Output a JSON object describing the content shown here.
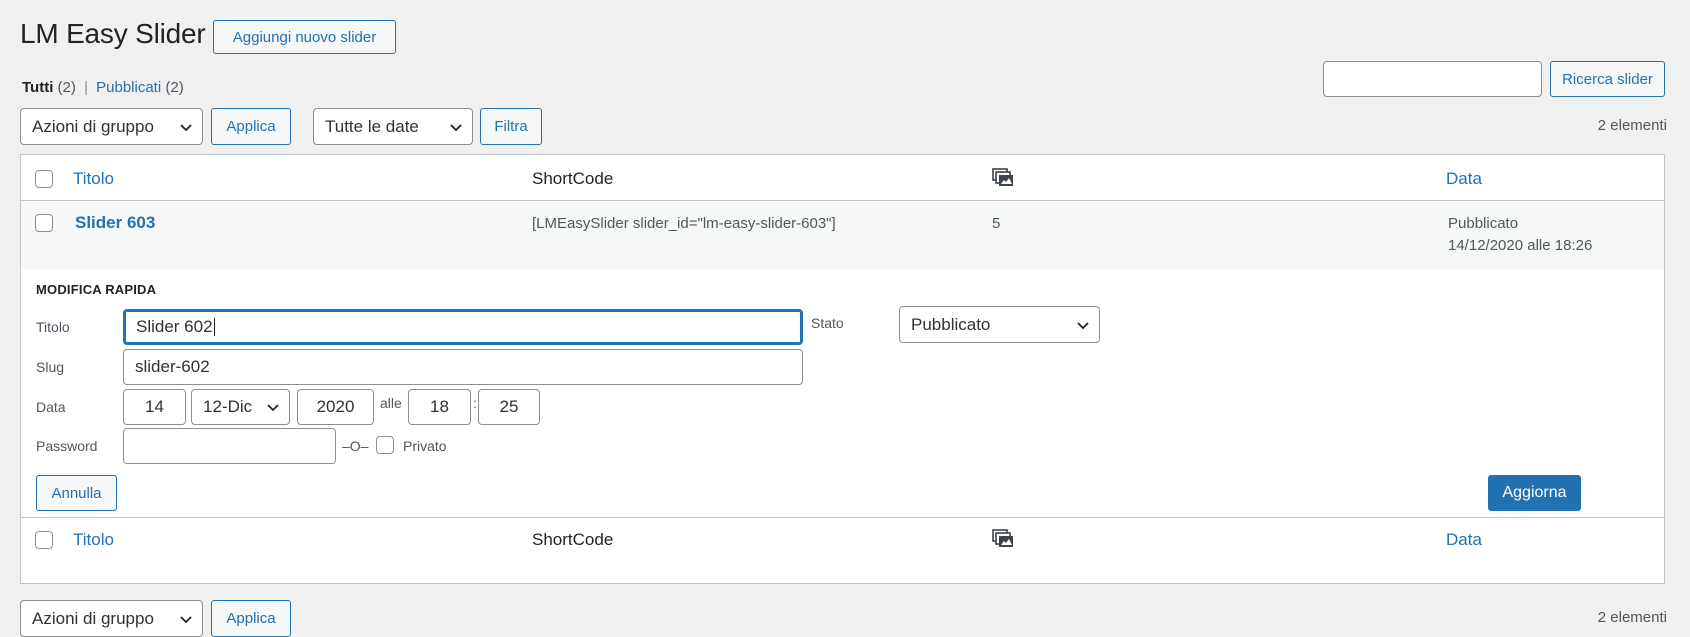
{
  "page": {
    "title": "LM Easy Slider",
    "add_new_label": "Aggiungi nuovo slider"
  },
  "views": {
    "all_label": "Tutti",
    "all_count": "(2)",
    "separator": "|",
    "published_label": "Pubblicati",
    "published_count": "(2)"
  },
  "search": {
    "value": "",
    "button_label": "Ricerca slider"
  },
  "tablenav_top": {
    "bulk_actions": "Azioni di gruppo",
    "apply_label": "Applica",
    "date_filter": "Tutte le date",
    "filter_label": "Filtra",
    "items_count": "2 elementi"
  },
  "table": {
    "columns": {
      "title": "Titolo",
      "shortcode": "ShortCode",
      "slides_icon": "images-icon",
      "date": "Data"
    },
    "rows": [
      {
        "title": "Slider 603",
        "shortcode": "[LMEasySlider slider_id=\"lm-easy-slider-603\"]",
        "slides": "5",
        "status": "Pubblicato",
        "date": "14/12/2020 alle 18:26"
      }
    ]
  },
  "quick_edit": {
    "heading": "MODIFICA RAPIDA",
    "title_label": "Titolo",
    "title_value": "Slider 602",
    "slug_label": "Slug",
    "slug_value": "slider-602",
    "date_label": "Data",
    "day": "14",
    "month": "12-Dic",
    "year": "2020",
    "at_label": "alle",
    "hour": "18",
    "time_sep": ":",
    "minute": "25",
    "password_label": "Password",
    "password_value": "",
    "or_label": "–O–",
    "private_label": "Privato",
    "status_label": "Stato",
    "status_value": "Pubblicato",
    "cancel_label": "Annulla",
    "update_label": "Aggiorna"
  },
  "tablenav_bottom": {
    "bulk_actions": "Azioni di gruppo",
    "apply_label": "Applica",
    "items_count": "2 elementi"
  },
  "colors": {
    "accent": "#2271b1",
    "background": "#f0f0f1",
    "border": "#c3c4c7"
  }
}
